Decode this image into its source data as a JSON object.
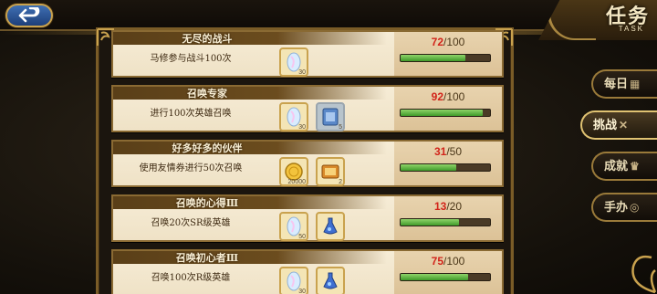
{
  "header": {
    "title": "任务",
    "subtitle": "TASK"
  },
  "tabs": [
    {
      "label": "每日",
      "icon": "calendar-icon",
      "active": false
    },
    {
      "label": "挑战",
      "icon": "crossed-swords-icon",
      "active": true
    },
    {
      "label": "成就",
      "icon": "trophy-icon",
      "active": false
    },
    {
      "label": "手办",
      "icon": "figure-icon",
      "active": false
    }
  ],
  "tasks": [
    {
      "name": "无尽的战斗",
      "desc": "马修参与战斗100次",
      "rewards": [
        {
          "icon": "crystal-icon",
          "qty": "30"
        }
      ],
      "current": "72",
      "total": "/100",
      "progress": 0.72
    },
    {
      "name": "召唤专家",
      "desc": "进行100次英雄召唤",
      "rewards": [
        {
          "icon": "crystal-icon",
          "qty": "30"
        },
        {
          "icon": "summon-ticket-icon",
          "qty": "5"
        }
      ],
      "current": "92",
      "total": "/100",
      "progress": 0.92
    },
    {
      "name": "好多好多的伙伴",
      "desc": "使用友情券进行50次召唤",
      "rewards": [
        {
          "icon": "gold-coin-icon",
          "qty": "20000"
        },
        {
          "icon": "friendship-voucher-icon",
          "qty": "2"
        }
      ],
      "current": "31",
      "total": "/50",
      "progress": 0.62
    },
    {
      "name": "召唤的心得Ⅲ",
      "desc": "召唤20次SR级英雄",
      "rewards": [
        {
          "icon": "crystal-icon",
          "qty": "50"
        },
        {
          "icon": "potion-icon",
          "qty": ""
        }
      ],
      "current": "13",
      "total": "/20",
      "progress": 0.65
    },
    {
      "name": "召唤初心者Ⅲ",
      "desc": "召唤100次R级英雄",
      "rewards": [
        {
          "icon": "crystal-icon",
          "qty": "30"
        },
        {
          "icon": "potion-icon",
          "qty": ""
        }
      ],
      "current": "75",
      "total": "/100",
      "progress": 0.75
    }
  ],
  "colors": {
    "accent_gold": "#c9a24e",
    "progress_current": "#d2241a",
    "progress_fill": "#5cb83c"
  }
}
